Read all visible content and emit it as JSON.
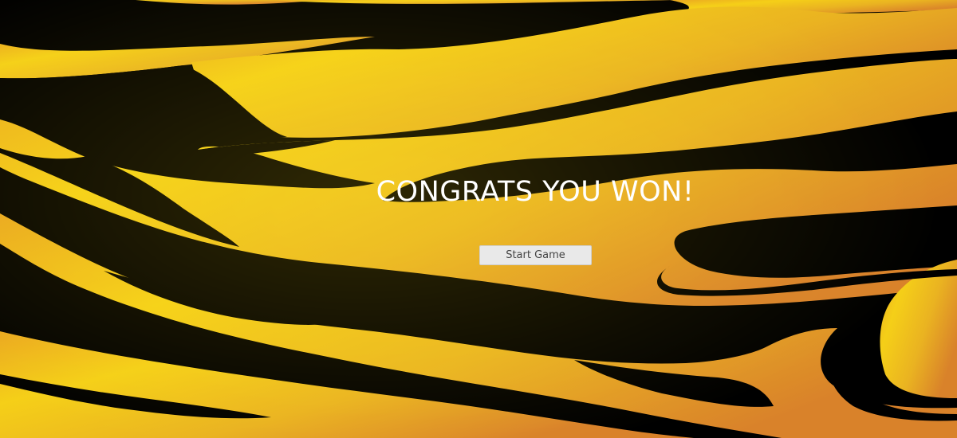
{
  "screen": {
    "headline": "CONGRATS YOU WON!",
    "start_button_label": "Start Game"
  },
  "background": {
    "pattern": "tiger-stripes",
    "colors": {
      "stripe": "#000000",
      "fur_light": "#f5cf18",
      "fur_mid": "#eaa720",
      "fur_dark": "#d9822a"
    }
  }
}
